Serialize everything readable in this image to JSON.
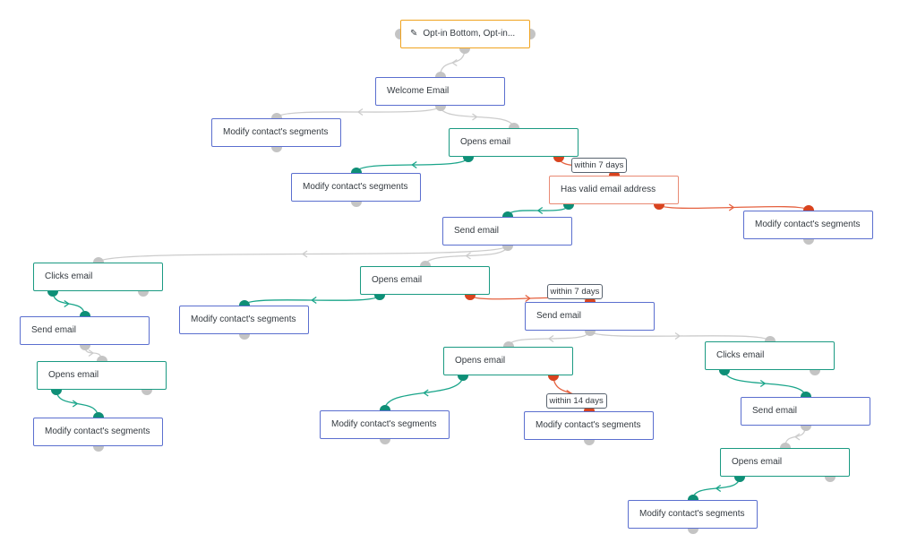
{
  "colors": {
    "action_border": "#5b6fcf",
    "decision_border": "#1a9a82",
    "condition_border": "#e98a74",
    "source_border": "#f0a31f",
    "yes_path": "#1aa58a",
    "no_path": "#e5613f",
    "neutral_path": "#cccccc",
    "yes_dot": "#0e8f77",
    "no_dot": "#d9431e",
    "neutral_dot": "#c4c4c4"
  },
  "nodes": [
    {
      "id": "n0",
      "label": "Opt-in Bottom, Opt-in...",
      "type": "source",
      "icon": "form-edit-icon"
    },
    {
      "id": "n1",
      "label": "Welcome Email",
      "type": "action"
    },
    {
      "id": "n2",
      "label": "Modify contact's segments",
      "type": "action"
    },
    {
      "id": "n3",
      "label": "Opens email",
      "type": "decision"
    },
    {
      "id": "n4",
      "label": "Modify contact's segments",
      "type": "action"
    },
    {
      "id": "n5",
      "label": "Has valid email address",
      "type": "condition"
    },
    {
      "id": "n6",
      "label": "Modify contact's segments",
      "type": "action"
    },
    {
      "id": "n7",
      "label": "Send email",
      "type": "action"
    },
    {
      "id": "n8",
      "label": "Clicks email",
      "type": "decision"
    },
    {
      "id": "n9",
      "label": "Opens email",
      "type": "decision"
    },
    {
      "id": "n10",
      "label": "Modify contact's segments",
      "type": "action"
    },
    {
      "id": "n11",
      "label": "Send email",
      "type": "action"
    },
    {
      "id": "n12",
      "label": "Send email",
      "type": "action"
    },
    {
      "id": "n13",
      "label": "Opens email",
      "type": "decision"
    },
    {
      "id": "n14",
      "label": "Modify contact's segments",
      "type": "action"
    },
    {
      "id": "n15",
      "label": "Opens email",
      "type": "decision"
    },
    {
      "id": "n16",
      "label": "Clicks email",
      "type": "decision"
    },
    {
      "id": "n17",
      "label": "Modify contact's segments",
      "type": "action"
    },
    {
      "id": "n18",
      "label": "Modify contact's segments",
      "type": "action"
    },
    {
      "id": "n19",
      "label": "Send email",
      "type": "action"
    },
    {
      "id": "n20",
      "label": "Opens email",
      "type": "decision"
    },
    {
      "id": "n21",
      "label": "Modify contact's segments",
      "type": "action"
    }
  ],
  "edges": [
    {
      "from": "n0",
      "to": "n1",
      "kind": "neutral"
    },
    {
      "from": "n1",
      "to": "n2",
      "kind": "neutral"
    },
    {
      "from": "n1",
      "to": "n3",
      "kind": "neutral"
    },
    {
      "from": "n3",
      "to": "n4",
      "kind": "yes"
    },
    {
      "from": "n3",
      "to": "n5",
      "kind": "no",
      "label": "within 7 days"
    },
    {
      "from": "n5",
      "to": "n7",
      "kind": "yes"
    },
    {
      "from": "n5",
      "to": "n6",
      "kind": "no"
    },
    {
      "from": "n7",
      "to": "n8",
      "kind": "neutral"
    },
    {
      "from": "n7",
      "to": "n9",
      "kind": "neutral"
    },
    {
      "from": "n8",
      "to": "n11",
      "kind": "yes"
    },
    {
      "from": "n11",
      "to": "n13",
      "kind": "neutral"
    },
    {
      "from": "n13",
      "to": "n14",
      "kind": "yes"
    },
    {
      "from": "n9",
      "to": "n10",
      "kind": "yes"
    },
    {
      "from": "n9",
      "to": "n12",
      "kind": "no",
      "label": "within 7 days"
    },
    {
      "from": "n12",
      "to": "n15",
      "kind": "neutral"
    },
    {
      "from": "n12",
      "to": "n16",
      "kind": "neutral"
    },
    {
      "from": "n15",
      "to": "n17",
      "kind": "yes"
    },
    {
      "from": "n15",
      "to": "n18",
      "kind": "no",
      "label": "within 14 days"
    },
    {
      "from": "n16",
      "to": "n19",
      "kind": "yes"
    },
    {
      "from": "n19",
      "to": "n20",
      "kind": "neutral"
    },
    {
      "from": "n20",
      "to": "n21",
      "kind": "yes"
    }
  ]
}
